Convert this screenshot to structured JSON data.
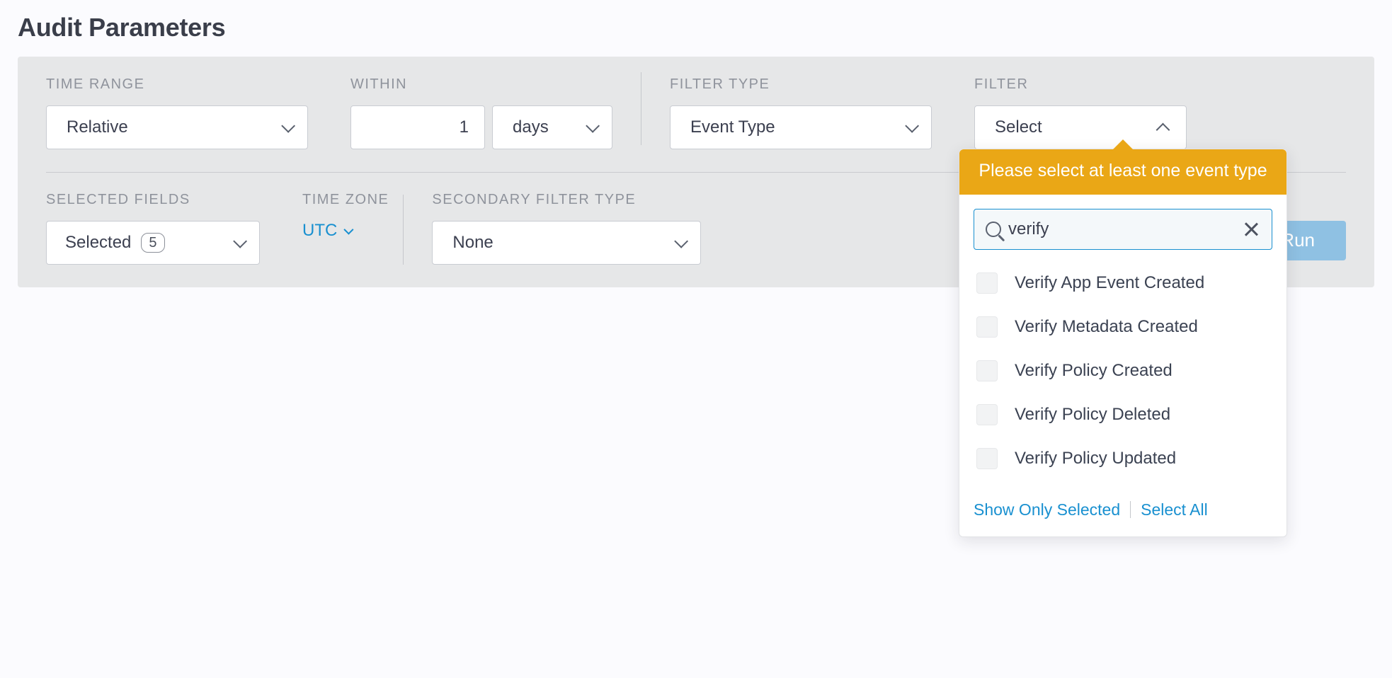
{
  "title": "Audit Parameters",
  "row1": {
    "timeRange": {
      "label": "TIME RANGE",
      "value": "Relative"
    },
    "within": {
      "label": "WITHIN",
      "number": "1",
      "unit": "days"
    },
    "filterType": {
      "label": "FILTER TYPE",
      "value": "Event Type"
    },
    "filter": {
      "label": "FILTER",
      "value": "Select"
    }
  },
  "row2": {
    "selectedFields": {
      "label": "SELECTED FIELDS",
      "value": "Selected",
      "count": "5"
    },
    "timeZone": {
      "label": "TIME ZONE",
      "value": "UTC"
    },
    "secondaryFilter": {
      "label": "SECONDARY FILTER TYPE",
      "value": "None"
    }
  },
  "dropdown": {
    "banner": "Please select at least one event type",
    "search": "verify",
    "options": [
      "Verify App Event Created",
      "Verify Metadata Created",
      "Verify Policy Created",
      "Verify Policy Deleted",
      "Verify Policy Updated"
    ],
    "showOnlySelected": "Show Only Selected",
    "selectAll": "Select All"
  },
  "run": "Run"
}
